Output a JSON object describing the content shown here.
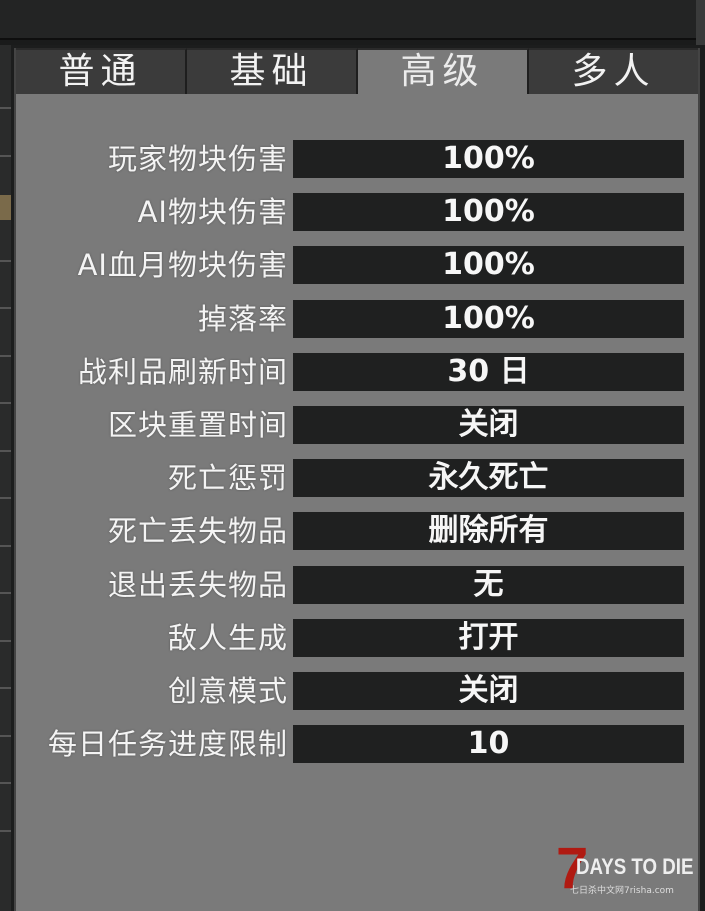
{
  "tabs": [
    {
      "label": "普通",
      "active": false
    },
    {
      "label": "基础",
      "active": false
    },
    {
      "label": "高级",
      "active": true
    },
    {
      "label": "多人",
      "active": false
    }
  ],
  "settings": [
    {
      "label": "玩家物块伤害",
      "value": "100%"
    },
    {
      "label": "AI物块伤害",
      "value": "100%"
    },
    {
      "label": "AI血月物块伤害",
      "value": "100%"
    },
    {
      "label": "掉落率",
      "value": "100%"
    },
    {
      "label": "战利品刷新时间",
      "value": "30 日"
    },
    {
      "label": "区块重置时间",
      "value": "关闭"
    },
    {
      "label": "死亡惩罚",
      "value": "永久死亡"
    },
    {
      "label": "死亡丢失物品",
      "value": "删除所有"
    },
    {
      "label": "退出丢失物品",
      "value": "无"
    },
    {
      "label": "敌人生成",
      "value": "打开"
    },
    {
      "label": "创意模式",
      "value": "关闭"
    },
    {
      "label": "每日任务进度限制",
      "value": "10"
    }
  ],
  "watermark": {
    "numeral": "7",
    "title": "DAYS TO DIE",
    "subtitle": "七日杀中文网7risha.com"
  },
  "colors": {
    "panel": "#7a7a7a",
    "tab_inactive": "#3b3b3b",
    "value_box": "#1f2020",
    "brand_red": "#b01a12"
  }
}
